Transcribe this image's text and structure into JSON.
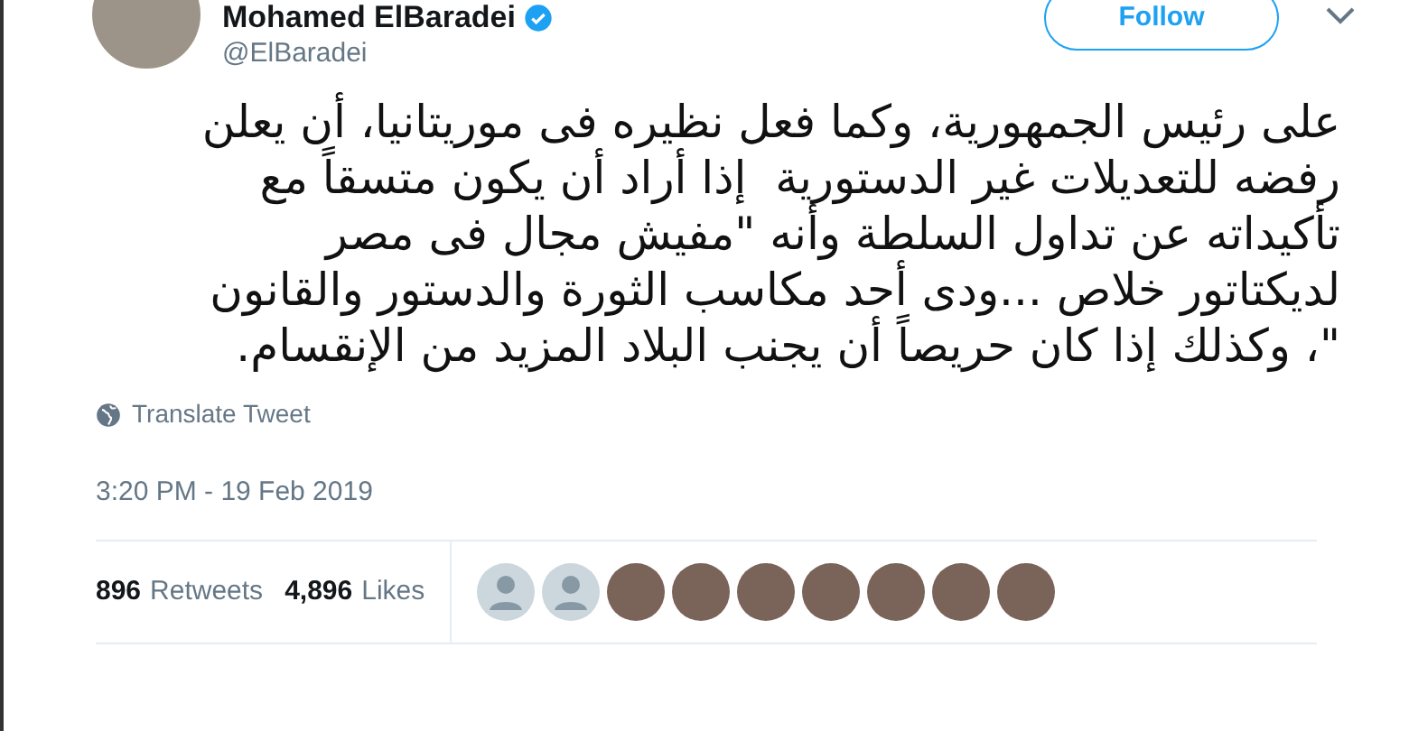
{
  "author": {
    "name": "Mohamed ElBaradei",
    "verified": true,
    "handle": "@ElBaradei"
  },
  "follow_button": "Follow",
  "tweet_lines": [
    "على رئيس الجمهورية، وكما فعل نظيره فى موريتانيا، أن يعلن",
    "رفضه للتعديلات غير الدستورية  إذا أراد أن يكون متسقاً مع",
    "تأكيداته عن تداول السلطة وأنه \"مفيش مجال فى مصر",
    "لديكتاتور خلاص ...ودى أحد مكاسب الثورة والدستور والقانون",
    "\"، وكذلك إذا كان حريصاً أن يجنب البلاد المزيد من الإنقسام."
  ],
  "translate_link": "Translate Tweet",
  "timestamp": "3:20 PM - 19 Feb 2019",
  "retweets": {
    "count": "896",
    "label": "Retweets"
  },
  "likes": {
    "count": "4,896",
    "label": "Likes"
  },
  "likers": [
    {
      "kind": "default"
    },
    {
      "kind": "default"
    },
    {
      "kind": "photo"
    },
    {
      "kind": "photo"
    },
    {
      "kind": "photo"
    },
    {
      "kind": "photo"
    },
    {
      "kind": "photo"
    },
    {
      "kind": "photo"
    },
    {
      "kind": "photo"
    }
  ]
}
